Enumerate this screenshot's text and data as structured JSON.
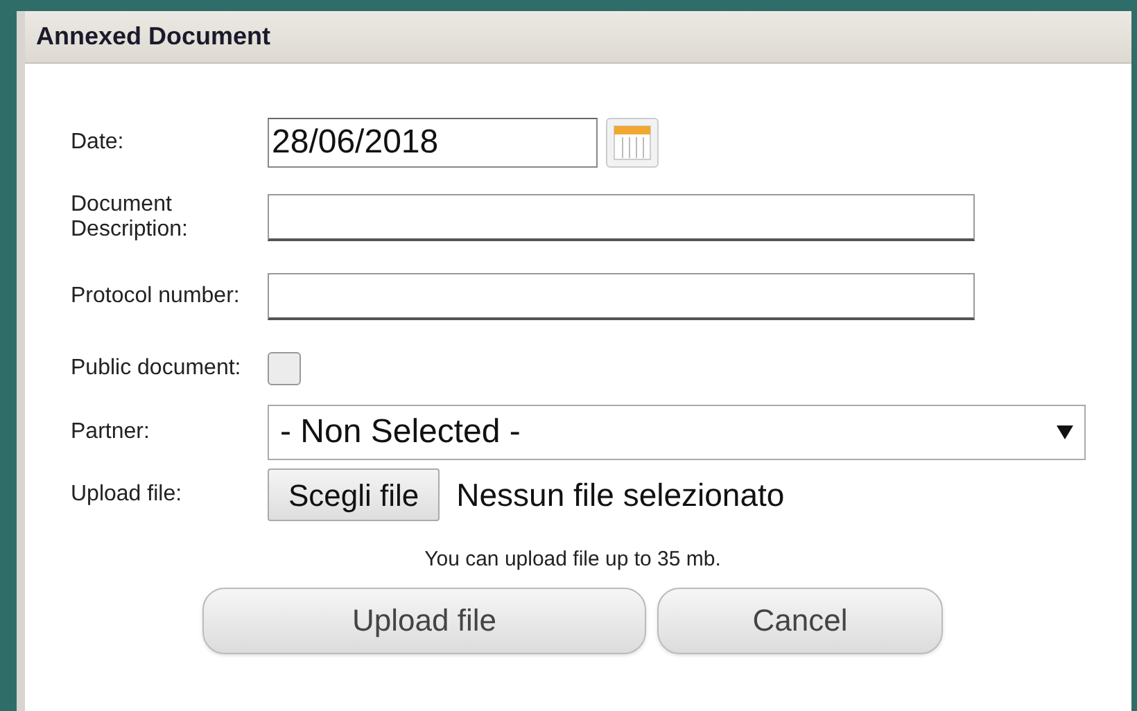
{
  "dialog": {
    "title": "Annexed Document"
  },
  "fields": [
    {
      "kind": "date",
      "label": "Date:",
      "value": "28/06/2018"
    },
    {
      "kind": "text",
      "label": "Document Description:"
    },
    {
      "kind": "text",
      "label": "Protocol number:"
    },
    {
      "kind": "checkbox",
      "label": "Public document:",
      "checked": false
    },
    {
      "kind": "select",
      "label": "Partner:",
      "value": "- Non Selected -"
    },
    {
      "kind": "file",
      "label": "Upload file:",
      "button": "Scegli file",
      "value": "Nessun file selezionato"
    }
  ],
  "note": "You can upload file up to 35 mb.",
  "buttons": [
    "Upload file",
    "Cancel"
  ]
}
